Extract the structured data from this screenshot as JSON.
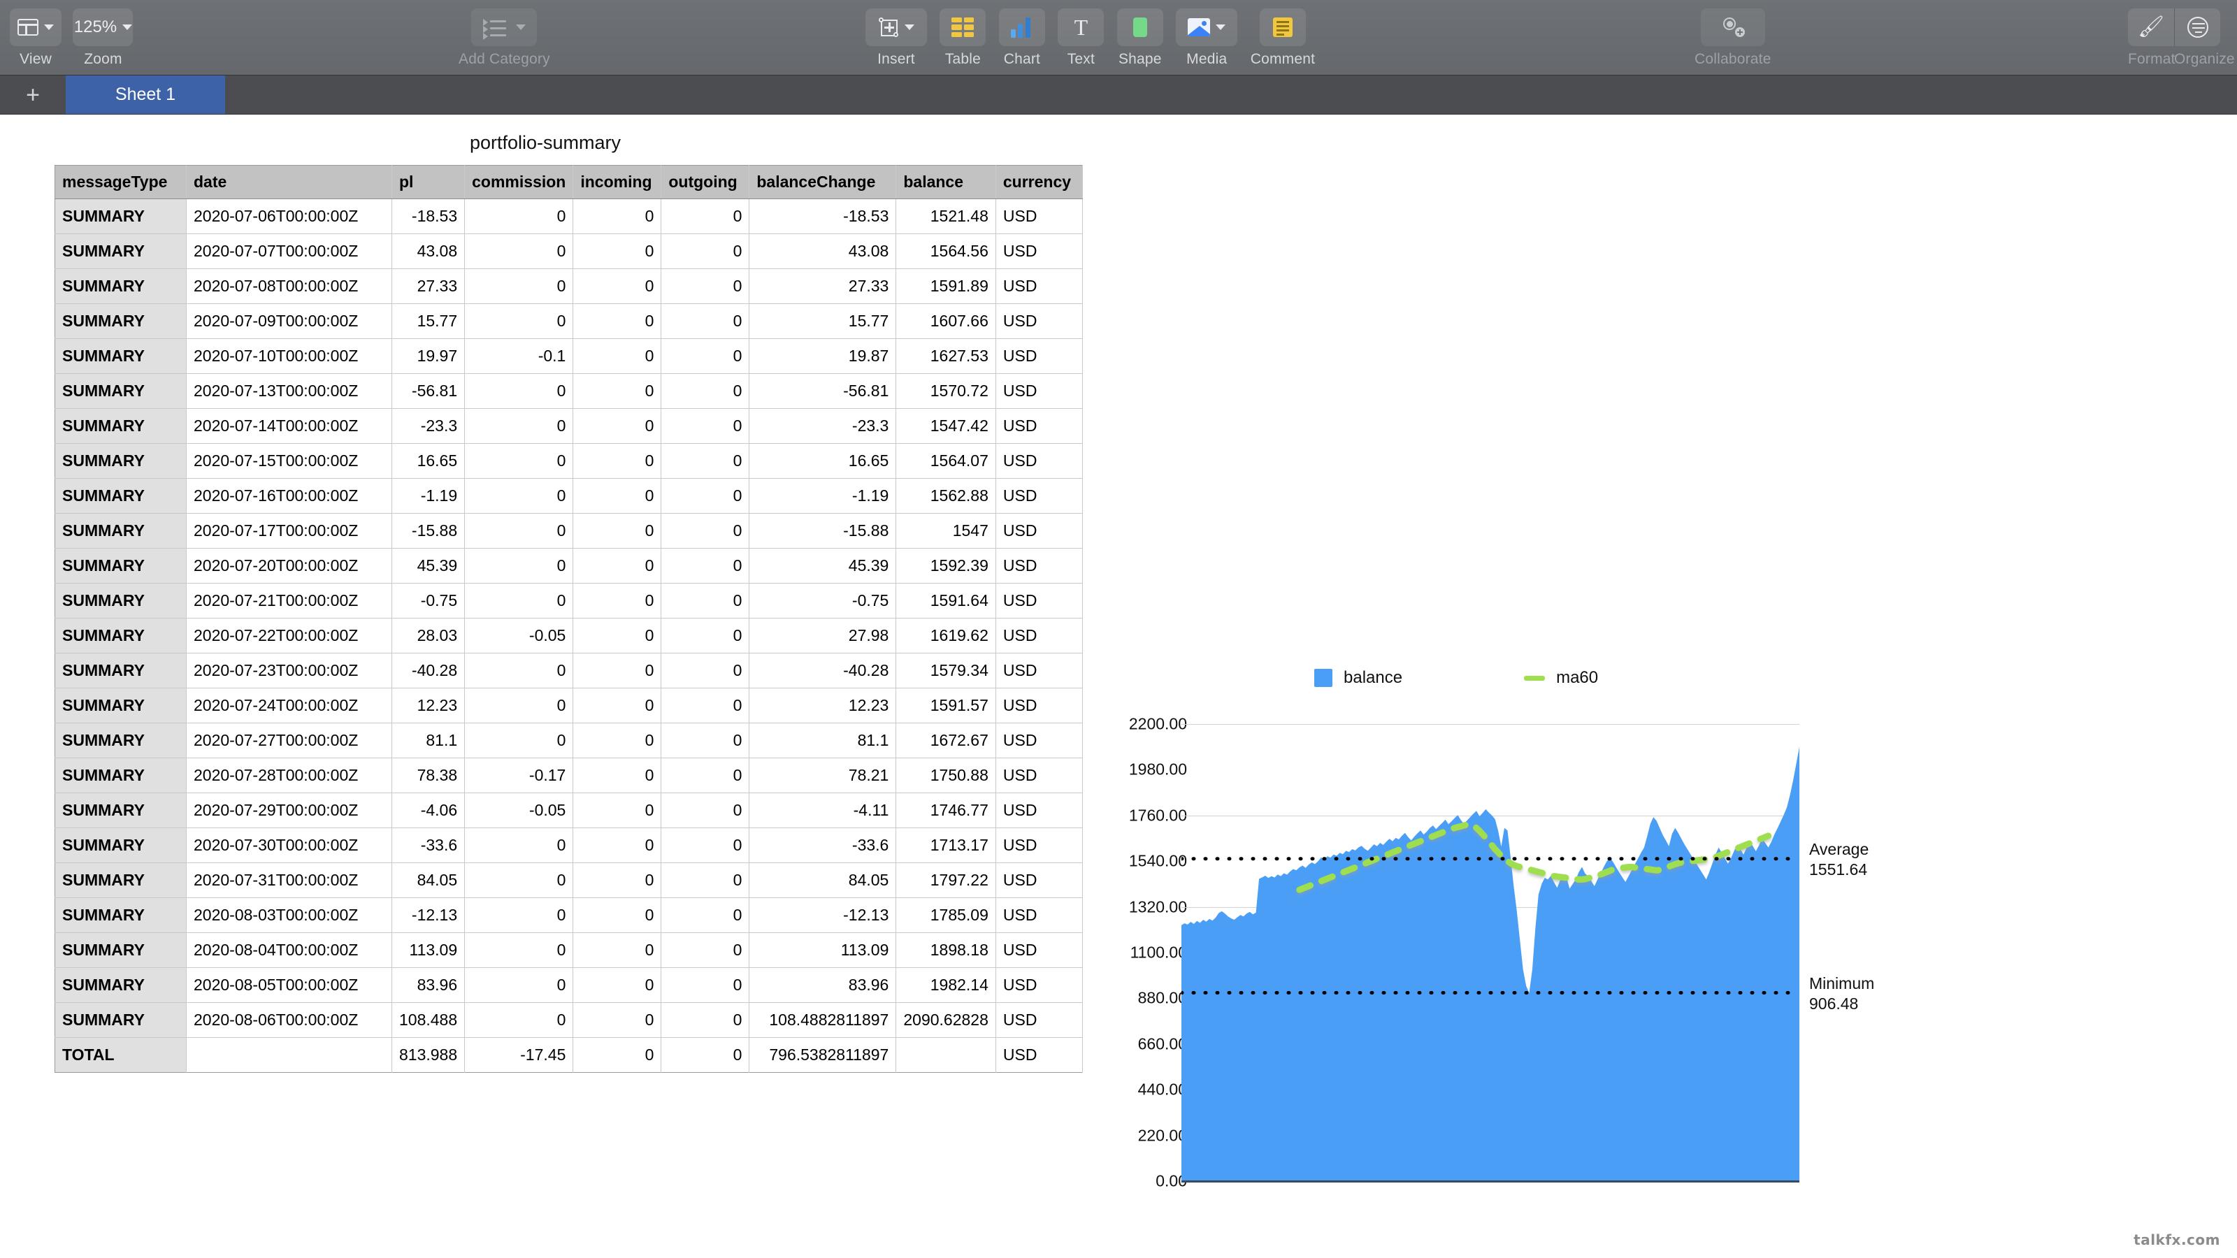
{
  "toolbar": {
    "left": [
      {
        "label": "View",
        "icon": "view-layout-icon",
        "has_chevron": true,
        "dim": false
      },
      {
        "label": "Zoom",
        "icon": "zoom-value",
        "value": "125%",
        "has_chevron": true,
        "dim": false
      }
    ],
    "add_category": {
      "label": "Add Category",
      "icon": "category-list-icon",
      "has_chevron": true,
      "dim": true
    },
    "center": [
      {
        "label": "Insert",
        "icon": "insert-object-icon",
        "has_chevron": true
      },
      {
        "label": "Table",
        "icon": "table-icon",
        "has_chevron": false
      },
      {
        "label": "Chart",
        "icon": "chart-icon",
        "has_chevron": false
      },
      {
        "label": "Text",
        "icon": "text-icon",
        "has_chevron": false
      },
      {
        "label": "Shape",
        "icon": "shape-icon",
        "has_chevron": false
      },
      {
        "label": "Media",
        "icon": "media-icon",
        "has_chevron": true
      },
      {
        "label": "Comment",
        "icon": "comment-icon",
        "has_chevron": false
      }
    ],
    "collaborate": {
      "label": "Collaborate",
      "icon": "collaborate-icon"
    },
    "right": [
      {
        "label": "Format",
        "icon": "format-brush-icon"
      },
      {
        "label": "Organize",
        "icon": "organize-icon"
      }
    ]
  },
  "tabbar": {
    "add_sheet": "+",
    "tabs": [
      {
        "label": "Sheet 1",
        "active": true
      }
    ]
  },
  "table": {
    "title": "portfolio-summary",
    "columns": [
      "messageType",
      "date",
      "pl",
      "commission",
      "incoming",
      "outgoing",
      "balanceChange",
      "balance",
      "currency"
    ],
    "rows": [
      [
        "SUMMARY",
        "2020-07-06T00:00:00Z",
        "-18.53",
        "0",
        "0",
        "0",
        "-18.53",
        "1521.48",
        "USD"
      ],
      [
        "SUMMARY",
        "2020-07-07T00:00:00Z",
        "43.08",
        "0",
        "0",
        "0",
        "43.08",
        "1564.56",
        "USD"
      ],
      [
        "SUMMARY",
        "2020-07-08T00:00:00Z",
        "27.33",
        "0",
        "0",
        "0",
        "27.33",
        "1591.89",
        "USD"
      ],
      [
        "SUMMARY",
        "2020-07-09T00:00:00Z",
        "15.77",
        "0",
        "0",
        "0",
        "15.77",
        "1607.66",
        "USD"
      ],
      [
        "SUMMARY",
        "2020-07-10T00:00:00Z",
        "19.97",
        "-0.1",
        "0",
        "0",
        "19.87",
        "1627.53",
        "USD"
      ],
      [
        "SUMMARY",
        "2020-07-13T00:00:00Z",
        "-56.81",
        "0",
        "0",
        "0",
        "-56.81",
        "1570.72",
        "USD"
      ],
      [
        "SUMMARY",
        "2020-07-14T00:00:00Z",
        "-23.3",
        "0",
        "0",
        "0",
        "-23.3",
        "1547.42",
        "USD"
      ],
      [
        "SUMMARY",
        "2020-07-15T00:00:00Z",
        "16.65",
        "0",
        "0",
        "0",
        "16.65",
        "1564.07",
        "USD"
      ],
      [
        "SUMMARY",
        "2020-07-16T00:00:00Z",
        "-1.19",
        "0",
        "0",
        "0",
        "-1.19",
        "1562.88",
        "USD"
      ],
      [
        "SUMMARY",
        "2020-07-17T00:00:00Z",
        "-15.88",
        "0",
        "0",
        "0",
        "-15.88",
        "1547",
        "USD"
      ],
      [
        "SUMMARY",
        "2020-07-20T00:00:00Z",
        "45.39",
        "0",
        "0",
        "0",
        "45.39",
        "1592.39",
        "USD"
      ],
      [
        "SUMMARY",
        "2020-07-21T00:00:00Z",
        "-0.75",
        "0",
        "0",
        "0",
        "-0.75",
        "1591.64",
        "USD"
      ],
      [
        "SUMMARY",
        "2020-07-22T00:00:00Z",
        "28.03",
        "-0.05",
        "0",
        "0",
        "27.98",
        "1619.62",
        "USD"
      ],
      [
        "SUMMARY",
        "2020-07-23T00:00:00Z",
        "-40.28",
        "0",
        "0",
        "0",
        "-40.28",
        "1579.34",
        "USD"
      ],
      [
        "SUMMARY",
        "2020-07-24T00:00:00Z",
        "12.23",
        "0",
        "0",
        "0",
        "12.23",
        "1591.57",
        "USD"
      ],
      [
        "SUMMARY",
        "2020-07-27T00:00:00Z",
        "81.1",
        "0",
        "0",
        "0",
        "81.1",
        "1672.67",
        "USD"
      ],
      [
        "SUMMARY",
        "2020-07-28T00:00:00Z",
        "78.38",
        "-0.17",
        "0",
        "0",
        "78.21",
        "1750.88",
        "USD"
      ],
      [
        "SUMMARY",
        "2020-07-29T00:00:00Z",
        "-4.06",
        "-0.05",
        "0",
        "0",
        "-4.11",
        "1746.77",
        "USD"
      ],
      [
        "SUMMARY",
        "2020-07-30T00:00:00Z",
        "-33.6",
        "0",
        "0",
        "0",
        "-33.6",
        "1713.17",
        "USD"
      ],
      [
        "SUMMARY",
        "2020-07-31T00:00:00Z",
        "84.05",
        "0",
        "0",
        "0",
        "84.05",
        "1797.22",
        "USD"
      ],
      [
        "SUMMARY",
        "2020-08-03T00:00:00Z",
        "-12.13",
        "0",
        "0",
        "0",
        "-12.13",
        "1785.09",
        "USD"
      ],
      [
        "SUMMARY",
        "2020-08-04T00:00:00Z",
        "113.09",
        "0",
        "0",
        "0",
        "113.09",
        "1898.18",
        "USD"
      ],
      [
        "SUMMARY",
        "2020-08-05T00:00:00Z",
        "83.96",
        "0",
        "0",
        "0",
        "83.96",
        "1982.14",
        "USD"
      ],
      [
        "SUMMARY",
        "2020-08-06T00:00:00Z",
        "108.488",
        "0",
        "0",
        "0",
        "108.4882811897",
        "2090.62828",
        "USD"
      ]
    ],
    "total_row": [
      "TOTAL",
      "",
      "813.988",
      "-17.45",
      "0",
      "0",
      "796.5382811897",
      "",
      "USD"
    ]
  },
  "chart_data": {
    "type": "area",
    "title": "",
    "xlabel": "",
    "ylabel": "",
    "ylim": [
      0,
      2200
    ],
    "yticks": [
      "2200.00",
      "1980.00",
      "1760.00",
      "1540.00",
      "1320.00",
      "1100.00",
      "880.00",
      "660.00",
      "440.00",
      "220.00",
      "0.00"
    ],
    "grid": true,
    "legend_position": "top",
    "colors": {
      "balance": "#4a9ef5",
      "ma60": "#9ede4f",
      "reference_line": "#000000"
    },
    "series": [
      {
        "name": "balance",
        "type": "area",
        "color": "#4a9ef5",
        "values": [
          1232,
          1241,
          1235,
          1248,
          1238,
          1252,
          1243,
          1258,
          1249,
          1262,
          1254,
          1268,
          1290,
          1299,
          1288,
          1274,
          1265,
          1258,
          1270,
          1281,
          1274,
          1288,
          1296,
          1284,
          1292,
          1455,
          1462,
          1470,
          1459,
          1468,
          1461,
          1476,
          1468,
          1482,
          1475,
          1490,
          1502,
          1496,
          1510,
          1519,
          1508,
          1524,
          1534,
          1526,
          1540,
          1558,
          1548,
          1564,
          1557,
          1572,
          1566,
          1580,
          1574,
          1590,
          1584,
          1598,
          1592,
          1606,
          1614,
          1600,
          1590,
          1605,
          1621,
          1612,
          1628,
          1618,
          1634,
          1648,
          1636,
          1652,
          1645,
          1662,
          1676,
          1656,
          1640,
          1658,
          1674,
          1688,
          1668,
          1682,
          1700,
          1712,
          1694,
          1710,
          1724,
          1740,
          1718,
          1732,
          1748,
          1762,
          1738,
          1720,
          1736,
          1752,
          1768,
          1782,
          1756,
          1772,
          1790,
          1774,
          1760,
          1742,
          1686,
          1610,
          1700,
          1688,
          1560,
          1420,
          1300,
          1160,
          1020,
          940,
          906,
          1020,
          1220,
          1380,
          1430,
          1460,
          1452,
          1470,
          1438,
          1412,
          1450,
          1476,
          1462,
          1408,
          1430,
          1452,
          1488,
          1512,
          1480,
          1468,
          1444,
          1420,
          1452,
          1480,
          1512,
          1540,
          1558,
          1536,
          1510,
          1486,
          1462,
          1440,
          1468,
          1496,
          1524,
          1552,
          1580,
          1606,
          1660,
          1720,
          1752,
          1734,
          1700,
          1666,
          1640,
          1612,
          1672,
          1700,
          1676,
          1648,
          1620,
          1596,
          1572,
          1548,
          1524,
          1500,
          1476,
          1452,
          1488,
          1530,
          1572,
          1606,
          1580,
          1554,
          1528,
          1556,
          1590,
          1620,
          1598,
          1572,
          1604,
          1636,
          1612,
          1588,
          1616,
          1650,
          1628,
          1606,
          1634,
          1670,
          1700,
          1732,
          1764,
          1800,
          1860,
          1930,
          2010,
          2090
        ]
      },
      {
        "name": "ma60",
        "type": "line",
        "style": "dashed",
        "color": "#9ede4f",
        "values": [
          null,
          null,
          null,
          null,
          null,
          null,
          null,
          null,
          null,
          null,
          null,
          null,
          null,
          null,
          null,
          null,
          null,
          null,
          null,
          null,
          null,
          null,
          null,
          null,
          null,
          null,
          null,
          null,
          null,
          null,
          null,
          null,
          null,
          null,
          null,
          null,
          null,
          null,
          1402,
          1408,
          1414,
          1420,
          1426,
          1432,
          1438,
          1444,
          1450,
          1456,
          1462,
          1468,
          1474,
          1480,
          1486,
          1492,
          1498,
          1504,
          1510,
          1516,
          1522,
          1528,
          1534,
          1540,
          1546,
          1552,
          1558,
          1564,
          1570,
          1576,
          1582,
          1588,
          1594,
          1600,
          1606,
          1612,
          1618,
          1624,
          1630,
          1636,
          1642,
          1648,
          1654,
          1660,
          1666,
          1672,
          1678,
          1684,
          1690,
          1696,
          1700,
          1704,
          1708,
          1712,
          1716,
          1718,
          1712,
          1700,
          1686,
          1670,
          1652,
          1634,
          1616,
          1598,
          1582,
          1566,
          1552,
          1540,
          1530,
          1522,
          1516,
          1512,
          1508,
          1504,
          1500,
          1496,
          1492,
          1488,
          1484,
          1480,
          1476,
          1472,
          1468,
          1466,
          1464,
          1462,
          1460,
          1458,
          1456,
          1454,
          1452,
          1452,
          1454,
          1458,
          1462,
          1466,
          1470,
          1476,
          1482,
          1488,
          1494,
          1500,
          1504,
          1506,
          1508,
          1510,
          1512,
          1512,
          1510,
          1508,
          1506,
          1504,
          1502,
          1500,
          1498,
          1496,
          1498,
          1502,
          1508,
          1514,
          1520,
          1526,
          1530,
          1534,
          1536,
          1538,
          1540,
          1542,
          1544,
          1546,
          1548,
          1550,
          1552,
          1556,
          1560,
          1566,
          1572,
          1578,
          1584,
          1590,
          1596,
          1602,
          1608,
          1614,
          1620,
          1626,
          1632,
          1638,
          1644,
          1650,
          1656,
          1662
        ]
      }
    ],
    "reference_lines": [
      {
        "name": "Average",
        "label": "Average",
        "value": "1551.64",
        "numeric": 1551.64,
        "style": "dotted",
        "color": "#000000"
      },
      {
        "name": "Minimum",
        "label": "Minimum",
        "value": "906.48",
        "numeric": 906.48,
        "style": "dotted",
        "color": "#000000"
      }
    ]
  },
  "watermark": {
    "text": "talkfx.com"
  }
}
